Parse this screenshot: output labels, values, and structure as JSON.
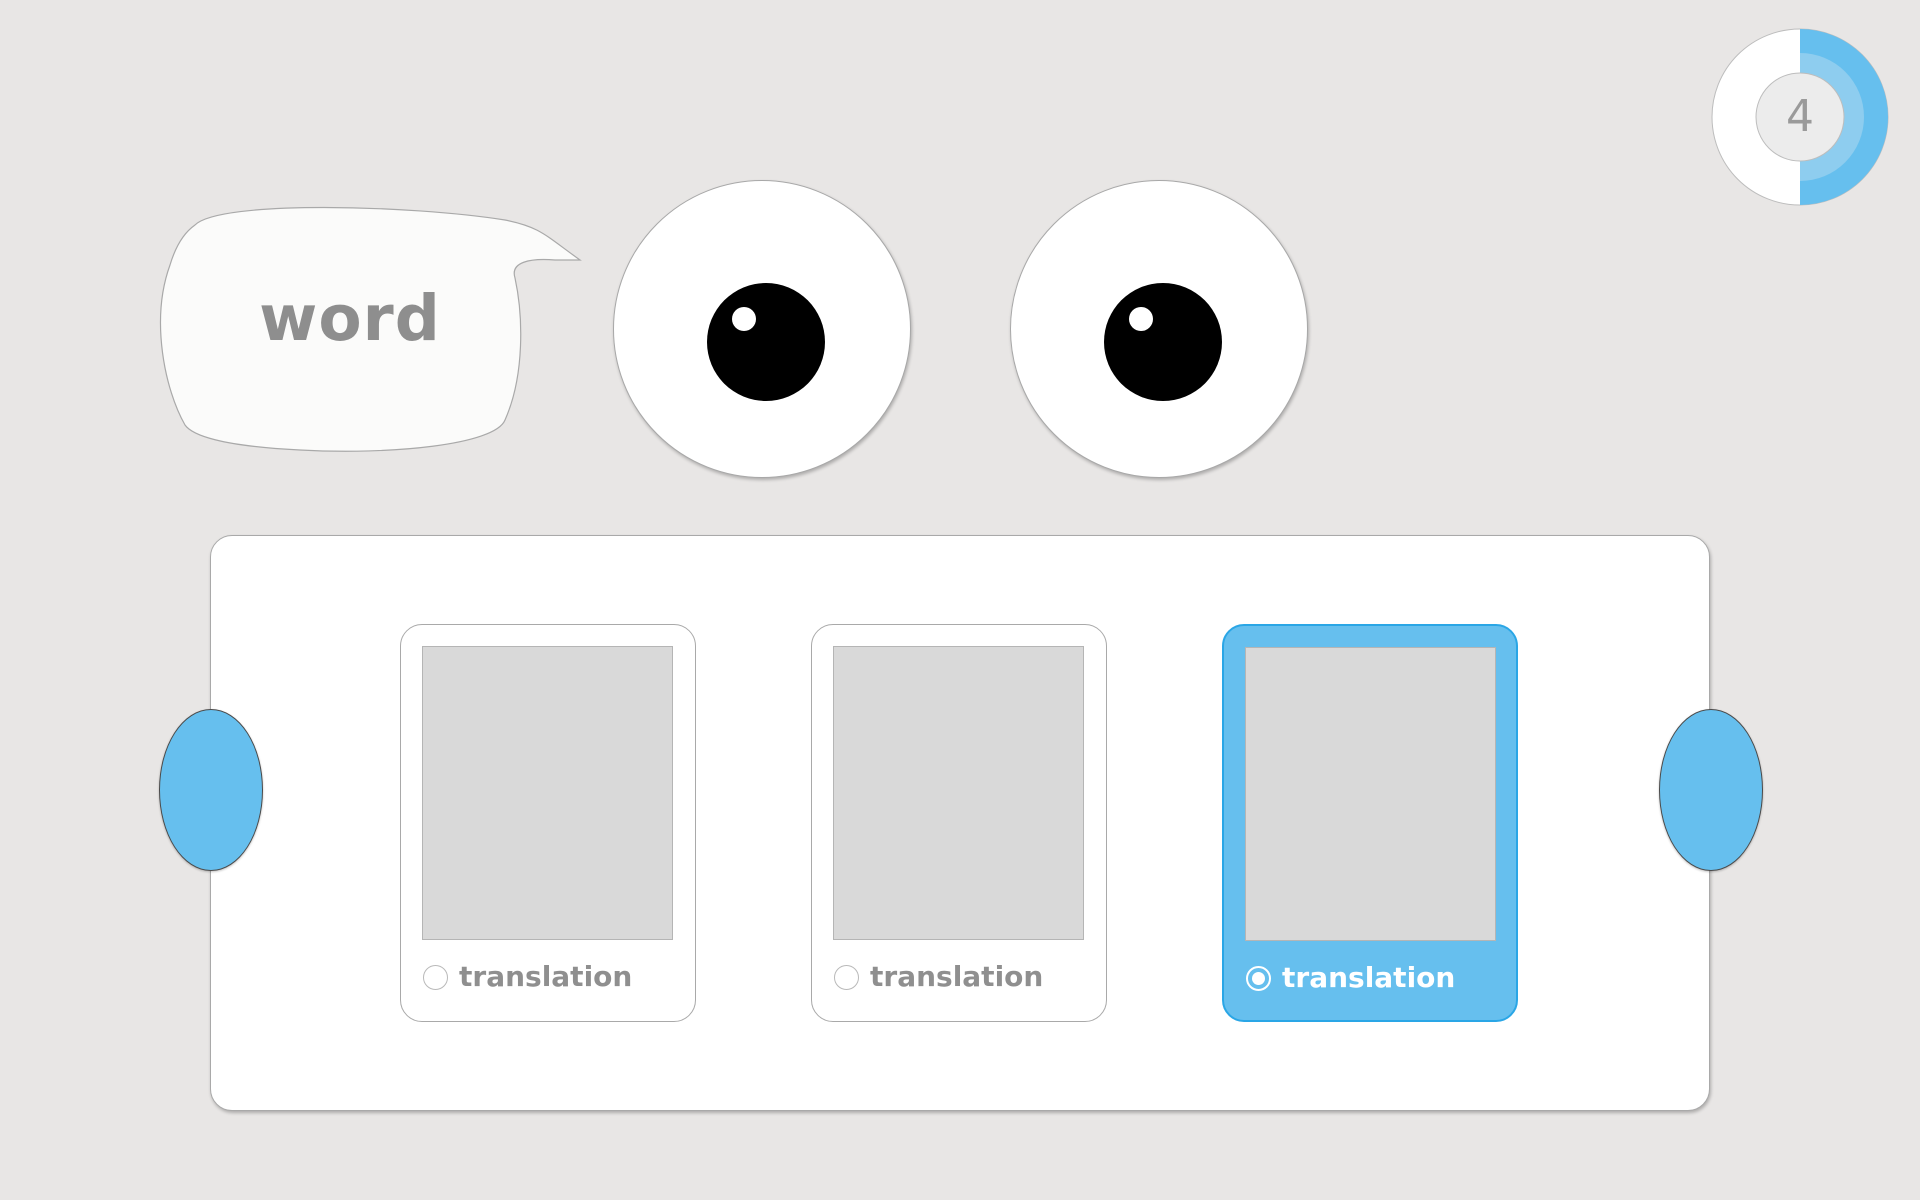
{
  "prompt": {
    "word": "word"
  },
  "timer": {
    "count": "4",
    "progress": 0.5,
    "accent_color": "#66bfee"
  },
  "options": [
    {
      "label": "translation",
      "selected": false
    },
    {
      "label": "translation",
      "selected": false
    },
    {
      "label": "translation",
      "selected": true
    }
  ],
  "colors": {
    "accent": "#66bfee",
    "background": "#e8e6e5",
    "text_muted": "#8e8e8e"
  },
  "icons": {
    "prev": "left-arrow-blob-icon",
    "next": "right-arrow-blob-icon"
  }
}
